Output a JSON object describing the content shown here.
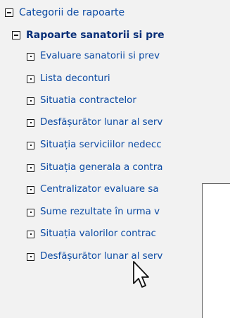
{
  "tree": {
    "root": {
      "label": "Categorii de rapoarte",
      "toggle": "-"
    },
    "group": {
      "label": "Rapoarte sanatorii si pre",
      "toggle": "-"
    },
    "items": [
      "Evaluare sanatorii si prev",
      "Lista deconturi",
      "Situatia contractelor",
      "Desfășurător lunar al serv",
      "Situația serviciilor nedecc",
      "Situația generala a contra",
      "Centralizator evaluare sa",
      "Sume rezultate în urma v",
      "Situația valorilor contrac",
      "Desfășurător lunar al serv"
    ]
  },
  "icons": {
    "expanded": "minus-box-icon",
    "leaf": "leaf-node-icon",
    "pointer": "mouse-pointer-icon"
  },
  "colors": {
    "background": "#f2f2f2",
    "link": "#0b4aa3",
    "group_link": "#092f78"
  }
}
